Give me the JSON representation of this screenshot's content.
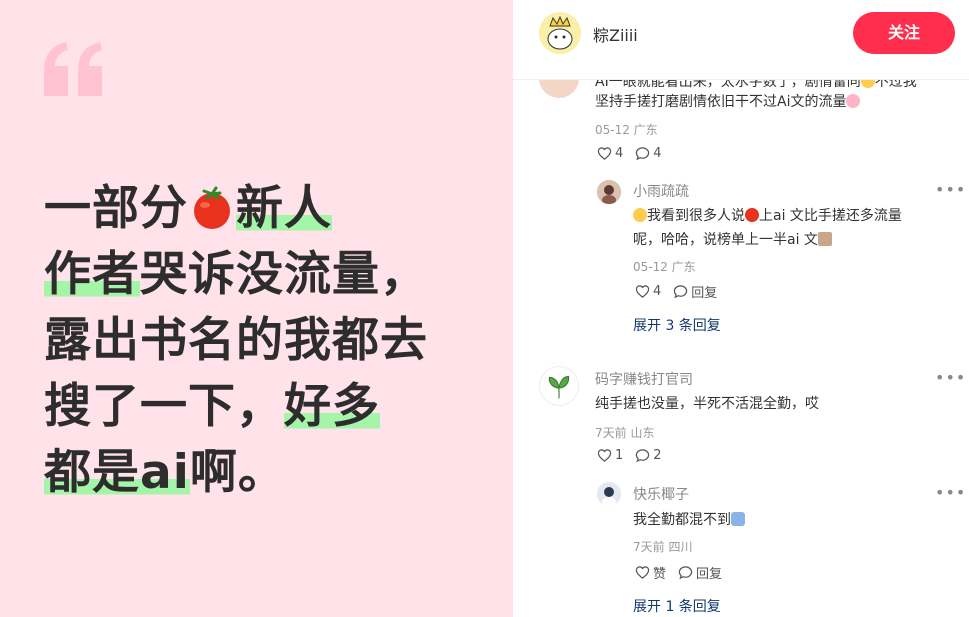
{
  "image": {
    "line1a": "一部分",
    "line1b": "新人",
    "line2a": "作者",
    "line2b": "哭诉没流量，",
    "line3": "露出书名的我都去",
    "line4a": "搜了一下，",
    "line4b": "好多",
    "line5a": "都是ai",
    "line5b": "啊。",
    "quote_icon": "quote-mark-icon",
    "highlight_color": "#a4f5a8",
    "background_color": "#ffe2ea"
  },
  "header": {
    "author": "粽Ziiii",
    "follow_label": "关注",
    "follow_color": "#ff2e4d"
  },
  "comments": [
    {
      "text_line1": "AI一眼就能看出来，太水字数了，剧情雷同",
      "text_line1b": "不过我",
      "text_line2": "坚持手搓打磨剧情依旧干不过Ai文的流量",
      "meta": "05-12 广东",
      "likes": "4",
      "replies": "4",
      "sub": {
        "name": "小雨疏疏",
        "text_line1a": "我看到很多人说",
        "text_line1b": "上ai 文比手搓还多流量",
        "text_line2": "呢，哈哈，说榜单上一半ai 文",
        "meta": "05-12 广东",
        "likes": "4",
        "reply_label": "回复"
      },
      "expand": "展开 3 条回复"
    },
    {
      "name": "码字赚钱打官司",
      "text": "纯手搓也没量，半死不活混全勤，哎",
      "meta": "7天前 山东",
      "likes": "1",
      "replies": "2",
      "sub": {
        "name": "快乐椰子",
        "text": "我全勤都混不到",
        "meta": "7天前 四川",
        "likes": "赞",
        "reply_label": "回复"
      },
      "expand": "展开 1 条回复"
    }
  ],
  "more_icon": "•••"
}
